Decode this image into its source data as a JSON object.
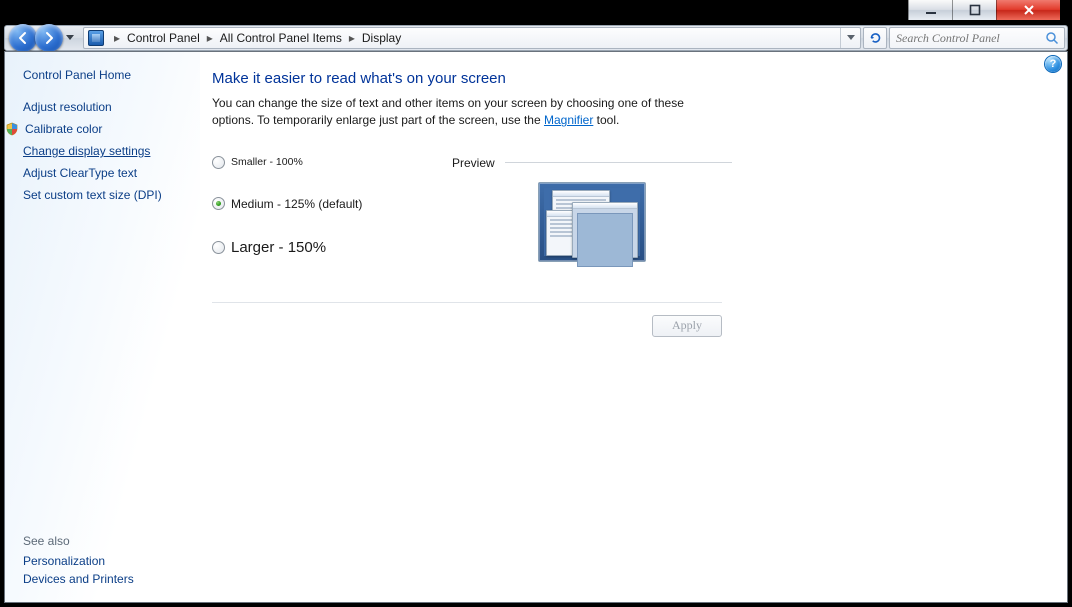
{
  "window_buttons": {
    "min": "minimize",
    "max": "maximize",
    "close": "close"
  },
  "breadcrumb": {
    "items": [
      "Control Panel",
      "All Control Panel Items",
      "Display"
    ]
  },
  "search": {
    "placeholder": "Search Control Panel"
  },
  "help": {
    "label": "?"
  },
  "sidebar": {
    "home": "Control Panel Home",
    "links": [
      {
        "label": "Adjust resolution",
        "icon": null
      },
      {
        "label": "Calibrate color",
        "icon": "shield"
      },
      {
        "label": "Change display settings",
        "icon": null,
        "current": true
      },
      {
        "label": "Adjust ClearType text",
        "icon": null
      },
      {
        "label": "Set custom text size (DPI)",
        "icon": null
      }
    ],
    "see_also": {
      "header": "See also",
      "links": [
        "Personalization",
        "Devices and Printers"
      ]
    }
  },
  "main": {
    "heading": "Make it easier to read what's on your screen",
    "lead_pre": "You can change the size of text and other items on your screen by choosing one of these options. To temporarily enlarge just part of the screen, use the ",
    "lead_link": "Magnifier",
    "lead_post": " tool.",
    "options": [
      {
        "label": "Smaller - 100%",
        "size": "small-t",
        "selected": false
      },
      {
        "label": "Medium - 125% (default)",
        "size": "med-t",
        "selected": true
      },
      {
        "label": "Larger - 150%",
        "size": "lrg-t",
        "selected": false
      }
    ],
    "preview_label": "Preview",
    "apply_label": "Apply"
  }
}
